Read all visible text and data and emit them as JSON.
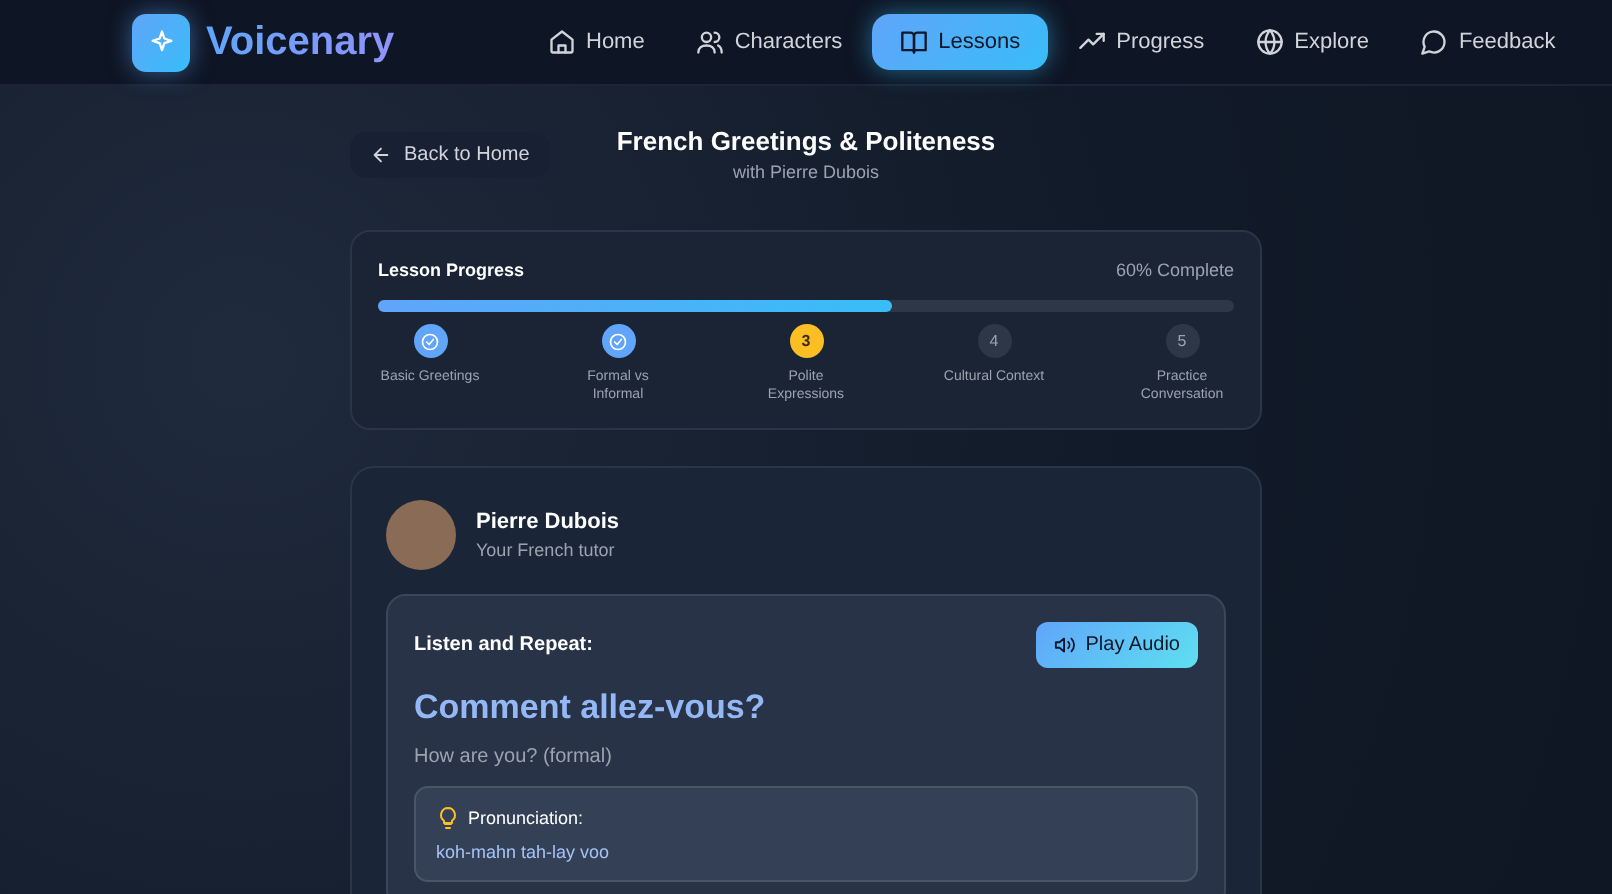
{
  "brand": {
    "name": "Voicenary"
  },
  "nav": [
    {
      "label": "Home",
      "selected": false
    },
    {
      "label": "Characters",
      "selected": false
    },
    {
      "label": "Lessons",
      "selected": true
    },
    {
      "label": "Progress",
      "selected": false
    },
    {
      "label": "Explore",
      "selected": false
    },
    {
      "label": "Feedback",
      "selected": false
    }
  ],
  "back_button": "Back to Home",
  "lesson": {
    "title": "French Greetings & Politeness",
    "subtitle": "with Pierre Dubois"
  },
  "progress": {
    "title": "Lesson Progress",
    "reading": "60% Complete",
    "level": 0.6,
    "steps": [
      {
        "label": "Basic Greetings",
        "kind": "done"
      },
      {
        "label": "Formal vs Informal",
        "kind": "done"
      },
      {
        "number": "3",
        "label": "Polite Expressions",
        "kind": "current"
      },
      {
        "number": "4",
        "label": "Cultural Context",
        "kind": "upcoming"
      },
      {
        "number": "5",
        "label": "Practice Conversation",
        "kind": "upcoming"
      }
    ]
  },
  "tutor": {
    "name": "Pierre Dubois",
    "role": "Your French tutor"
  },
  "exercise": {
    "prompt": "Listen and Repeat:",
    "play_button": "Play Audio",
    "phrase": "Comment allez-vous?",
    "translation": "How are you? (formal)",
    "pronunciation_label": "Pronunciation:",
    "pronunciation": "koh-mahn tah-lay voo"
  }
}
